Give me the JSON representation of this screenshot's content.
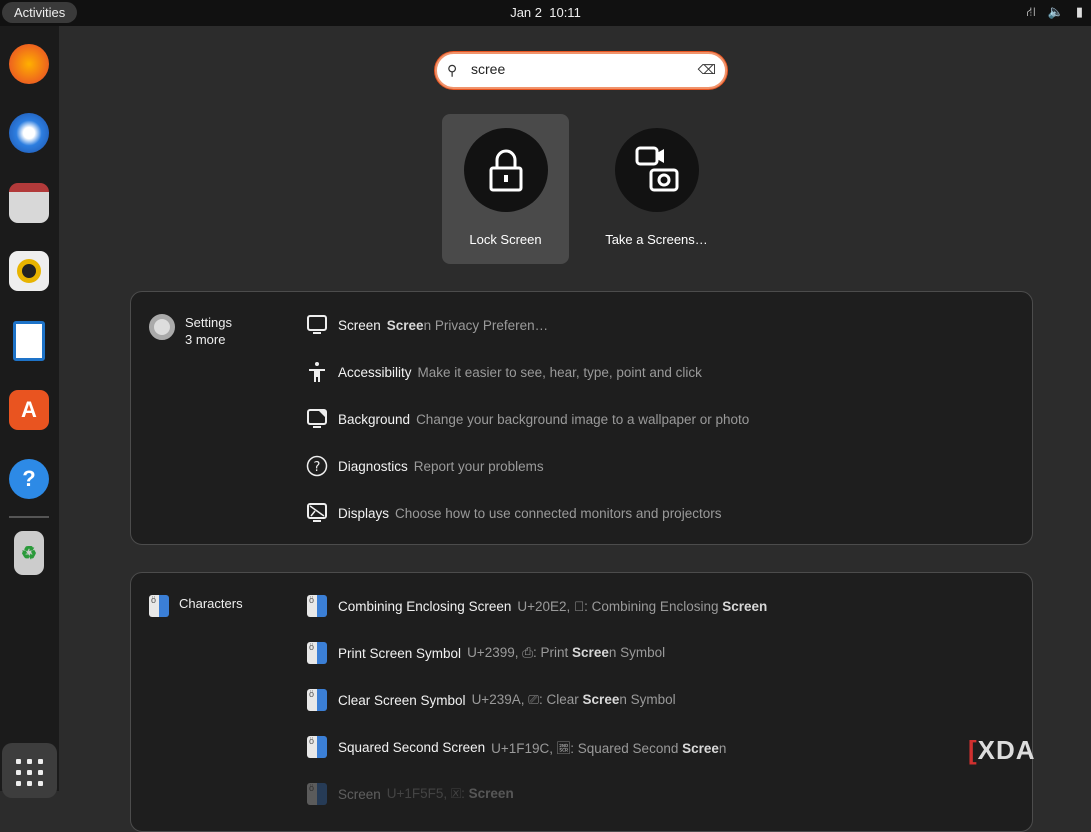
{
  "topbar": {
    "activities": "Activities",
    "date": "Jan 2",
    "time": "10:11",
    "tray_icons": [
      "network-icon",
      "volume-icon",
      "battery-icon"
    ]
  },
  "dock": {
    "apps": [
      "Firefox",
      "Thunderbird",
      "Files",
      "Rhythmbox",
      "LibreOffice Writer",
      "Ubuntu Software",
      "Help",
      "Trash"
    ],
    "show_apps": "Show Applications"
  },
  "search": {
    "value": "scree",
    "accent": "#e95420"
  },
  "apps": [
    {
      "label": "Lock Screen",
      "icon": "lock-icon",
      "selected": true
    },
    {
      "label": "Take a Screens…",
      "icon": "screenshot-icon",
      "selected": false
    }
  ],
  "settings": {
    "name": "Settings",
    "more": "3 more",
    "rows": [
      {
        "icon": "monitor-icon",
        "title": "Screen",
        "desc": [
          {
            "t": "",
            "b": "Scree"
          },
          {
            "t": "n Privacy Preferen…"
          }
        ]
      },
      {
        "icon": "accessibility-icon",
        "title": "Accessibility",
        "desc": [
          {
            "t": "Make it easier to see, hear, type, point and click"
          }
        ]
      },
      {
        "icon": "background-icon",
        "title": "Background",
        "desc": [
          {
            "t": "Change your background image to a wallpaper or photo"
          }
        ]
      },
      {
        "icon": "help-icon",
        "title": "Diagnostics",
        "desc": [
          {
            "t": "Report your problems"
          }
        ]
      },
      {
        "icon": "displays-icon",
        "title": "Displays",
        "desc": [
          {
            "t": "Choose how to use connected monitors and projectors"
          }
        ]
      }
    ]
  },
  "characters": {
    "name": "Characters",
    "rows": [
      {
        "title": "Combining Enclosing Screen",
        "pre": "U+20E2, ⃢: Combining Enclosing ",
        "b": "Screen",
        "post": ""
      },
      {
        "title": "Print Screen Symbol",
        "pre": "U+2399, ⎙: Print ",
        "b": "Scree",
        "post": "n Symbol"
      },
      {
        "title": "Clear Screen Symbol",
        "pre": "U+239A, ⎚: Clear ",
        "b": "Scree",
        "post": "n Symbol"
      },
      {
        "title": "Squared Second Screen",
        "pre": "U+1F19C, 🆜: Squared Second ",
        "b": "Scree",
        "post": "n"
      },
      {
        "title": "Screen",
        "pre": "U+1F5F5, 🗵: ",
        "b": "Screen",
        "post": ""
      }
    ]
  },
  "watermark": "XDA"
}
